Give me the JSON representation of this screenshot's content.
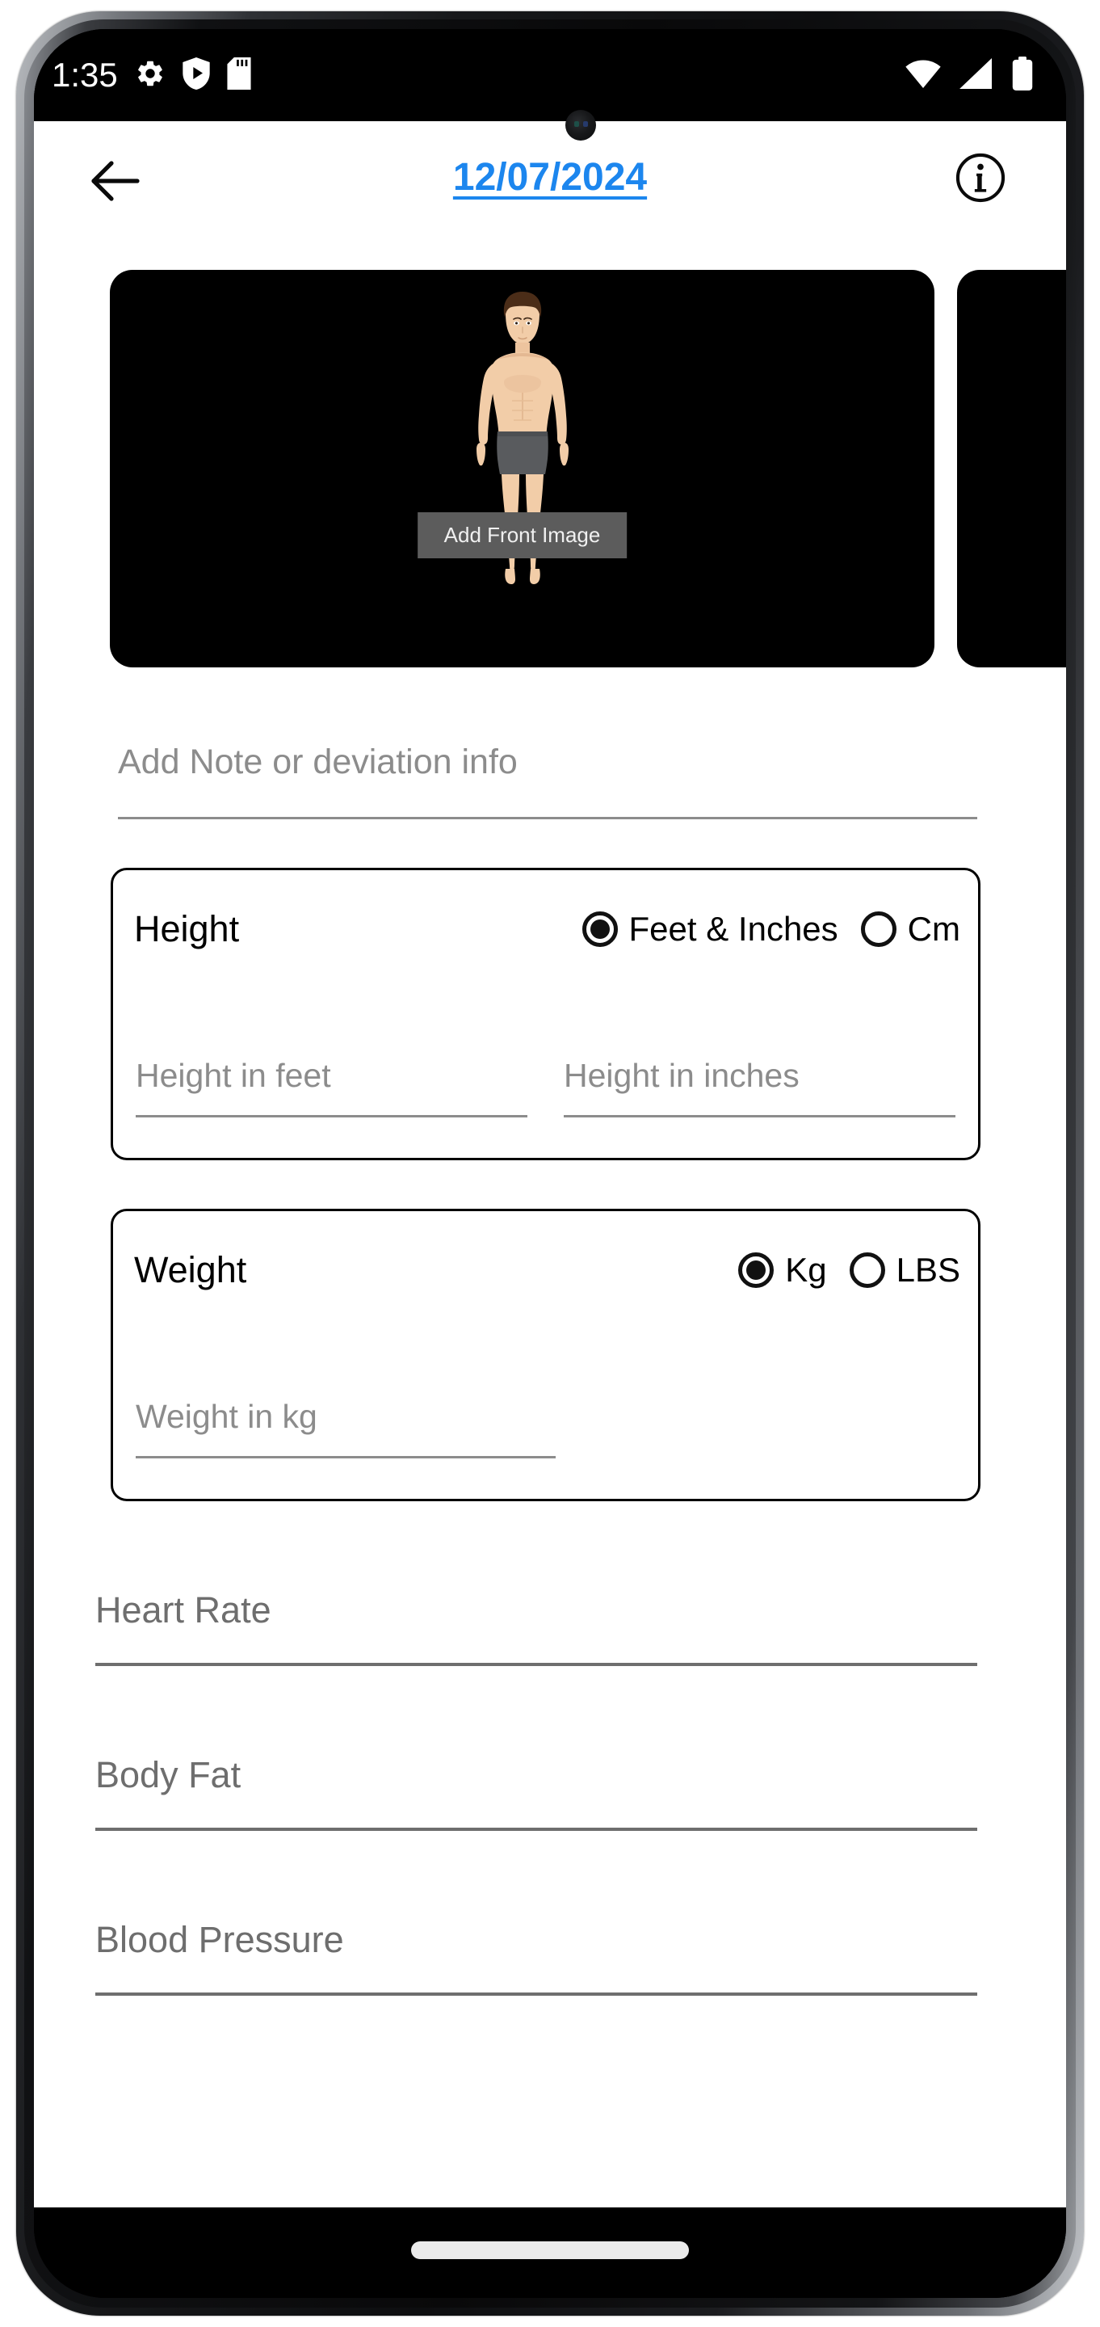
{
  "status_bar": {
    "time": "1:35",
    "left_icons": [
      "gear-icon",
      "shield-play-icon",
      "sd-card-icon"
    ],
    "right_icons": [
      "wifi-icon",
      "cell-signal-icon",
      "battery-icon"
    ]
  },
  "header": {
    "back_icon": "back-arrow-icon",
    "date": "12/07/2024",
    "date_color": "#1c86ee",
    "info_icon": "info-circle-icon"
  },
  "carousel": {
    "cards": [
      {
        "label": "Add Front Image",
        "name": "front-image-card"
      },
      {
        "label": "",
        "name": "back-image-card"
      }
    ]
  },
  "note": {
    "placeholder": "Add Note or deviation info",
    "value": ""
  },
  "height_section": {
    "title": "Height",
    "options": [
      {
        "label": "Feet & Inches",
        "selected": true
      },
      {
        "label": "Cm",
        "selected": false
      }
    ],
    "inputs": [
      {
        "placeholder": "Height in feet",
        "value": ""
      },
      {
        "placeholder": "Height in inches",
        "value": ""
      }
    ]
  },
  "weight_section": {
    "title": "Weight",
    "options": [
      {
        "label": "Kg",
        "selected": true
      },
      {
        "label": "LBS",
        "selected": false
      }
    ],
    "inputs": [
      {
        "placeholder": "Weight in kg",
        "value": ""
      }
    ]
  },
  "metrics": [
    {
      "placeholder": "Heart Rate",
      "value": ""
    },
    {
      "placeholder": "Body Fat",
      "value": ""
    },
    {
      "placeholder": "Blood Pressure",
      "value": ""
    }
  ],
  "nav_bar": {
    "home_indicator": "home-indicator"
  },
  "colors": {
    "accent": "#1c86ee",
    "placeholder": "#8c8c8c",
    "metric_placeholder": "#6e6e6e",
    "card_bg": "#000000",
    "overlay_label_bg": "#5c5c5c"
  }
}
